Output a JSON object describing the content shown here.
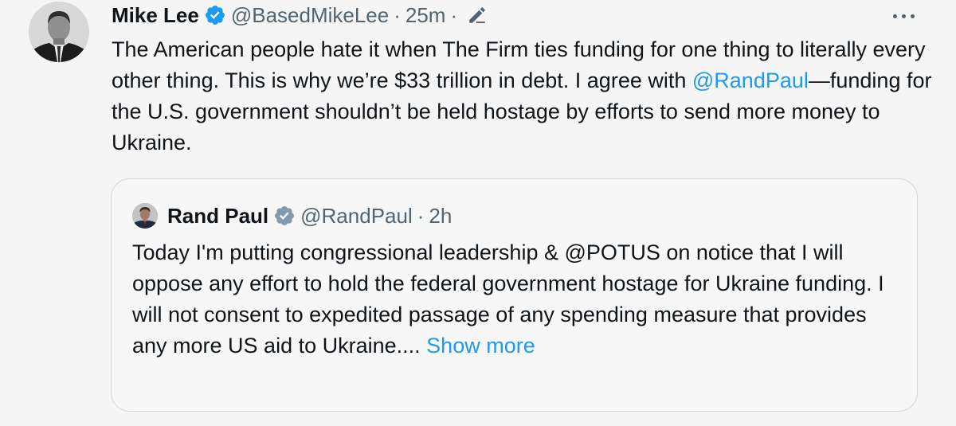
{
  "tweet": {
    "author_name": "Mike Lee",
    "handle": "@BasedMikeLee",
    "separator": "·",
    "time": "25m",
    "text_before_mention": "The American people hate it when The Firm ties funding for one thing to literally every other thing. This is why we’re $33 trillion in debt. I agree with ",
    "mention": "@RandPaul",
    "text_after_mention": "—funding for the U.S. government shouldn’t be held hostage by efforts to send more money to Ukraine."
  },
  "quoted_tweet": {
    "author_name": "Rand Paul",
    "handle": "@RandPaul",
    "separator": "·",
    "time": "2h",
    "text": "Today I'm putting congressional leadership & @POTUS on notice that I will oppose any effort to hold the federal government hostage for Ukraine funding. I will not consent to expedited passage of any spending measure that provides any more US aid to Ukraine....",
    "show_more_label": "Show more"
  },
  "icons": {
    "verified": "verified-badge-icon",
    "edit": "edit-pencil-icon",
    "more": "more-options-icon"
  },
  "colors": {
    "background": "#f5f5f5",
    "text_primary": "#0f1419",
    "text_secondary": "#536471",
    "link": "#1d9bf0",
    "verified": "#1d9bf0",
    "quote_border": "#cfd9de"
  }
}
